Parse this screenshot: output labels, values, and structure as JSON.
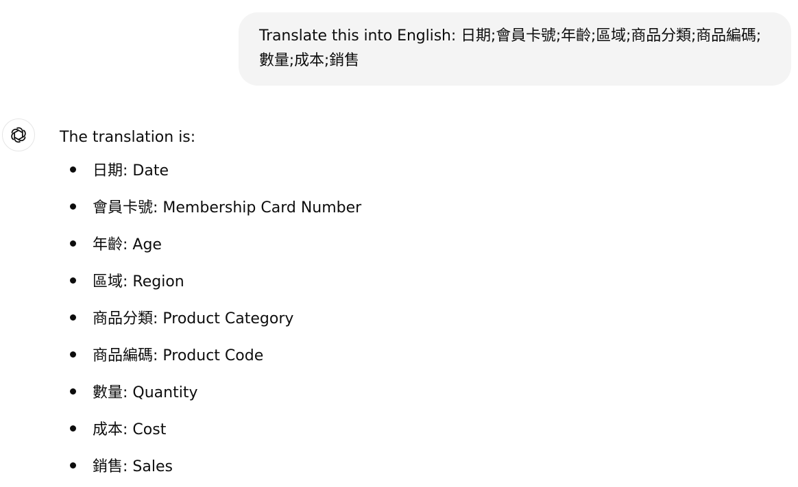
{
  "user_message": {
    "text": "Translate this into English: 日期;會員卡號;年齡;區域;商品分類;商品編碼;數量;成本;銷售"
  },
  "assistant": {
    "avatar_icon": "openai-logo-icon",
    "intro": "The translation is:",
    "items": [
      {
        "label": "日期: Date"
      },
      {
        "label": "會員卡號: Membership Card Number"
      },
      {
        "label": "年齡: Age"
      },
      {
        "label": "區域: Region"
      },
      {
        "label": "商品分類: Product Category"
      },
      {
        "label": "商品編碼: Product Code"
      },
      {
        "label": "數量: Quantity"
      },
      {
        "label": "成本: Cost"
      },
      {
        "label": "銷售: Sales"
      }
    ]
  }
}
